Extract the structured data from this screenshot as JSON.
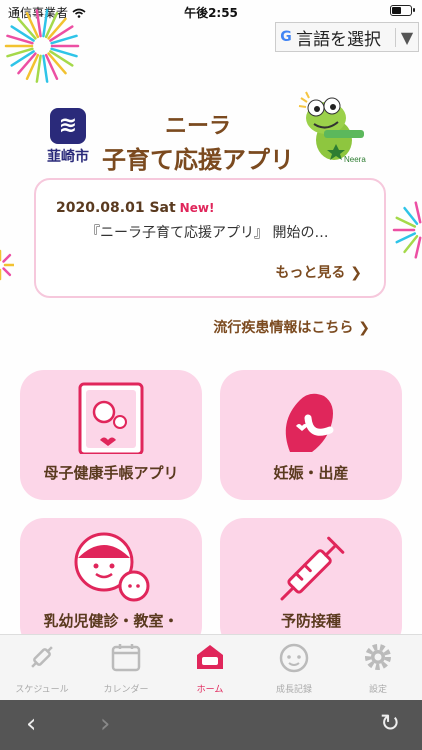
{
  "status": {
    "carrier": "通信事業者",
    "time": "午後2:55",
    "battery_level": 0.5
  },
  "language_selector": {
    "g": "G",
    "label": "言語を選択",
    "arrow": "▼"
  },
  "header": {
    "city": "韮崎市",
    "city_mark": "≋",
    "title_line1": "ニーラ",
    "title_line2": "子育て応援アプリ"
  },
  "news": {
    "date": "2020.08.01 Sat",
    "new_badge": "New!",
    "body": "『ニーラ子育て応援アプリ』 開始の…",
    "more": "もっと見る ❯"
  },
  "epidemic_link": "流行疾患情報はこちら ❯",
  "tiles": [
    {
      "label": "母子健康手帳アプリ"
    },
    {
      "label": "妊娠・出産"
    },
    {
      "label": "乳幼児健診・教室・"
    },
    {
      "label": "予防接種"
    }
  ],
  "tabbar": {
    "items": [
      {
        "label": "スケジュール",
        "icon": "syringe-icon"
      },
      {
        "label": "カレンダー",
        "icon": "calendar-icon"
      },
      {
        "label": "ホーム",
        "icon": "home-icon"
      },
      {
        "label": "成長記録",
        "icon": "baby-face-icon"
      },
      {
        "label": "設定",
        "icon": "gear-icon"
      }
    ],
    "active": "ホーム"
  },
  "browser": {
    "back": "‹",
    "forward": "›",
    "reload": "↻"
  },
  "colors": {
    "accent": "#e0265b",
    "brown": "#7b4a1f",
    "tile": "#fcd6e8",
    "pink_line": "#f6c8dc"
  }
}
